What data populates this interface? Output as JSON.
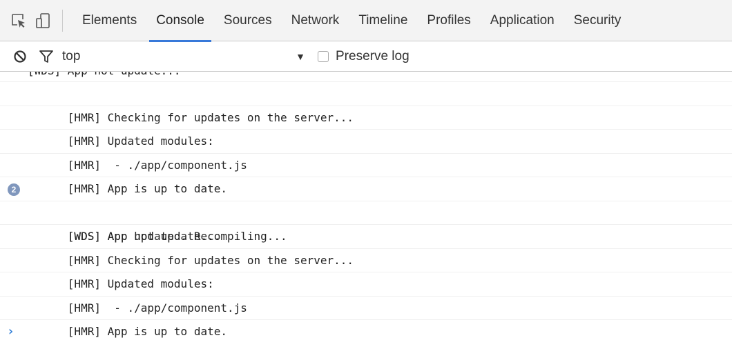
{
  "tabbar": {
    "tabs": [
      {
        "label": "Elements",
        "active": false
      },
      {
        "label": "Console",
        "active": true
      },
      {
        "label": "Sources",
        "active": false
      },
      {
        "label": "Network",
        "active": false
      },
      {
        "label": "Timeline",
        "active": false
      },
      {
        "label": "Profiles",
        "active": false
      },
      {
        "label": "Application",
        "active": false
      },
      {
        "label": "Security",
        "active": false
      }
    ],
    "icons": [
      "inspect-element-icon",
      "device-mode-icon"
    ]
  },
  "toolbar": {
    "icons": [
      "clear-console-icon",
      "filter-icon"
    ],
    "context": "top",
    "context_arrow": "▼",
    "preserve_log_label": "Preserve log",
    "preserve_log_checked": false
  },
  "console": {
    "clipped_message": "[WDS] App hot update...",
    "messages": [
      {
        "text": "[HMR] Checking for updates on the server...",
        "count": ""
      },
      {
        "text": "[HMR] Updated modules:",
        "count": ""
      },
      {
        "text": "[HMR]  - ./app/component.js",
        "count": ""
      },
      {
        "text": "[HMR] App is up to date.",
        "count": ""
      },
      {
        "text": "[WDS] App updated. Recompiling...",
        "count": "2"
      },
      {
        "text": "[WDS] App hot update...",
        "count": ""
      },
      {
        "text": "[HMR] Checking for updates on the server...",
        "count": ""
      },
      {
        "text": "[HMR] Updated modules:",
        "count": ""
      },
      {
        "text": "[HMR]  - ./app/component.js",
        "count": ""
      },
      {
        "text": "[HMR] App is up to date.",
        "count": ""
      }
    ],
    "prompt_symbol": "›"
  },
  "colors": {
    "accent": "#3879d9",
    "badge": "#8097bd",
    "prompt": "#2b7bd6"
  }
}
